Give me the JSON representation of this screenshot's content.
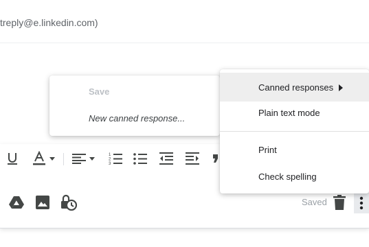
{
  "header": {
    "sender_text": "treply@e.linkedin.com)"
  },
  "canned_submenu": {
    "save_label": "Save",
    "new_label": "New canned response..."
  },
  "more_menu": {
    "items": [
      {
        "label": "Canned responses"
      },
      {
        "label": "Plain text mode"
      },
      {
        "label": "Print"
      },
      {
        "label": "Check spelling"
      }
    ]
  },
  "footer": {
    "saved_label": "Saved"
  },
  "colors": {
    "icon": "#444746",
    "menu_highlight": "#eeeeee",
    "muted_text": "#9aa0a6"
  },
  "icons": [
    "underline-icon",
    "text-color-icon",
    "align-icon",
    "numbered-list-icon",
    "bulleted-list-icon",
    "indent-less-icon",
    "indent-more-icon",
    "quote-icon",
    "drive-icon",
    "photo-icon",
    "confidential-mode-icon",
    "trash-icon",
    "more-vertical-icon"
  ]
}
